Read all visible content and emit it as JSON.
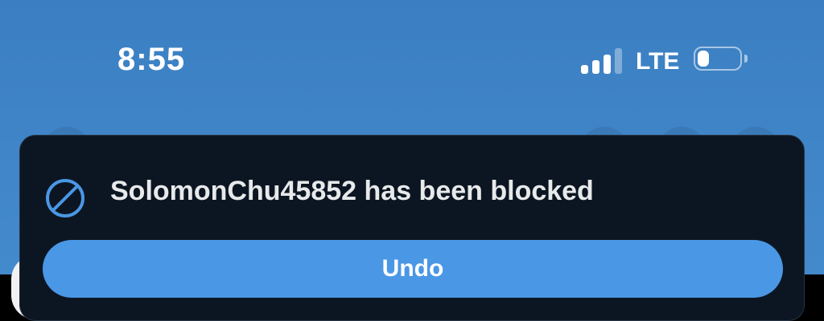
{
  "status_bar": {
    "time": "8:55",
    "network": "LTE",
    "signal_bars_active": 3,
    "signal_bars_total": 4,
    "battery_level": 0.28
  },
  "toast": {
    "icon": "blocked-icon",
    "message": "SolomonChu45852 has been blocked",
    "undo_label": "Undo"
  },
  "colors": {
    "header_blue": "#3b7fc2",
    "toast_bg": "#0c1622",
    "accent_blue": "#4a97e5",
    "text": "#e7e9ea"
  }
}
